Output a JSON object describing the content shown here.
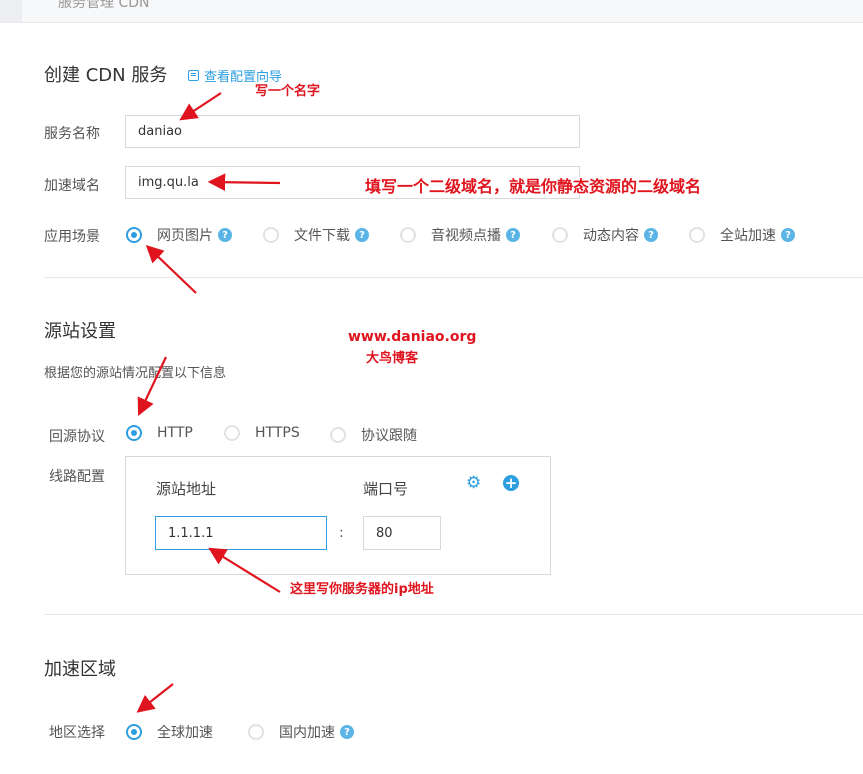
{
  "topbar": {
    "breadcrumb": "服务管理 CDN"
  },
  "create": {
    "title": "创建 CDN 服务",
    "guide_link": "查看配置向导",
    "service_name_label": "服务名称",
    "service_name_value": "daniao",
    "domain_label": "加速域名",
    "domain_value": "img.qu.la",
    "scenario_label": "应用场景",
    "scenarios": [
      "网页图片",
      "文件下载",
      "音视频点播",
      "动态内容",
      "全站加速"
    ],
    "scenario_selected": "网页图片"
  },
  "origin": {
    "title": "源站设置",
    "subtitle": "根据您的源站情况配置以下信息",
    "protocol_label": "回源协议",
    "protocols": [
      "HTTP",
      "HTTPS",
      "协议跟随"
    ],
    "protocol_selected": "HTTP",
    "line_label": "线路配置",
    "col_address": "源站地址",
    "col_port": "端口号",
    "address_value": "1.1.1.1",
    "separator": ":",
    "port_value": "80"
  },
  "region": {
    "title": "加速区域",
    "select_label": "地区选择",
    "options": [
      "全球加速",
      "国内加速"
    ],
    "selected": "全球加速"
  },
  "annotations": {
    "name_note": "写一个名字",
    "domain_note": "填写一个二级域名，就是你静态资源的二级域名",
    "site_url": "www.daniao.org",
    "site_name": "大鸟博客",
    "ip_note": "这里写你服务器的ip地址"
  },
  "colors": {
    "accent": "#2d9ee0",
    "annotation": "#e0141e"
  },
  "icons": [
    "guide-icon",
    "help-icon",
    "gear-icon",
    "plus-circle-icon"
  ]
}
